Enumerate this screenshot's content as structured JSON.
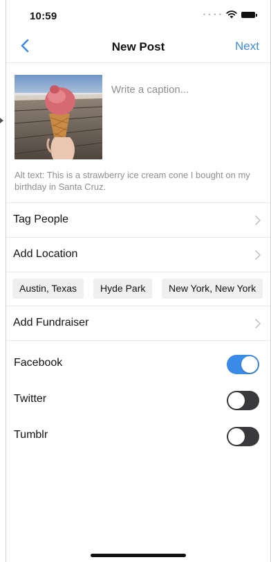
{
  "status_bar": {
    "time": "10:59",
    "signal_icon": "signal-dots",
    "wifi_icon": "wifi",
    "battery_icon": "battery-full"
  },
  "nav": {
    "back_icon": "chevron-left",
    "title": "New Post",
    "next_label": "Next",
    "accent_color": "#3a8ae8"
  },
  "composer": {
    "photo_subject": "strawberry ice cream cone",
    "caption_value": "",
    "caption_placeholder": "Write a caption...",
    "alt_text": "Alt text: This is a strawberry ice cream cone I bought on my birthday in Santa Cruz."
  },
  "rows": {
    "tag_people": "Tag People",
    "add_location": "Add Location",
    "add_fundraiser": "Add Fundraiser"
  },
  "location_suggestions": [
    "Austin, Texas",
    "Hyde Park",
    "New York, New York"
  ],
  "share": [
    {
      "label": "Facebook",
      "on": true
    },
    {
      "label": "Twitter",
      "on": false
    },
    {
      "label": "Tumblr",
      "on": false
    }
  ]
}
